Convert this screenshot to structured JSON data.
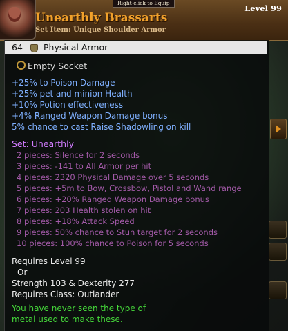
{
  "tooltip": {
    "equip_hint": "Right-click to Equip",
    "title": "Unearthly Brassarts",
    "subtitle": "Set Item: Unique Shoulder Armor",
    "level": "Level 99",
    "armor_value": "64",
    "armor_label": "Physical Armor",
    "socket": "Empty Socket",
    "stats": [
      "+25% to Poison Damage",
      "+25% pet and minion Health",
      "+10% Potion effectiveness",
      "+4% Ranged Weapon Damage bonus",
      "5% chance to cast Raise Shadowling on kill"
    ],
    "set_name": "Set: Unearthly",
    "set_bonuses": [
      "2 pieces: Silence for 2 seconds",
      "3 pieces: -141 to All Armor per hit",
      "4 pieces: 2320 Physical Damage over 5 seconds",
      "5 pieces: +5m to Bow, Crossbow, Pistol and Wand range",
      "6 pieces: +20% Ranged Weapon Damage bonus",
      "7 pieces: 203 Health stolen on hit",
      "8 pieces: +18% Attack Speed",
      "9 pieces: 50% chance to Stun target for 2 seconds",
      "10 pieces: 100% chance to Poison for 5 seconds"
    ],
    "requirements": [
      "Requires Level 99",
      "Or",
      "Strength 103 & Dexterity 277",
      "Requires Class: Outlander"
    ],
    "flavor": [
      "You have never seen the type of",
      "metal used to make these."
    ]
  },
  "colors": {
    "title": "#f1a12b",
    "magic_stat": "#7fb0ff",
    "set_name": "#d27cff",
    "set_bonus": "#a35aa8",
    "flavor": "#45d63a"
  }
}
